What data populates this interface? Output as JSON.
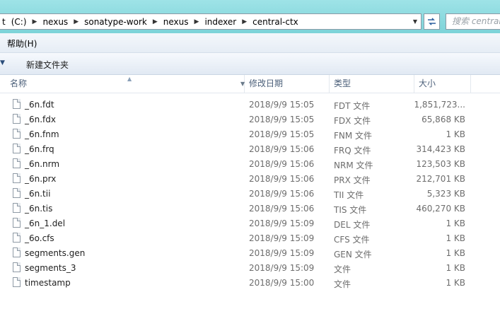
{
  "address": {
    "crumbs": [
      "(C:)",
      "nexus",
      "sonatype-work",
      "nexus",
      "indexer",
      "central-ctx"
    ],
    "prefix_fragment": "t",
    "search_placeholder": "搜索 central-ctx"
  },
  "menu": {
    "help": "帮助(H)"
  },
  "toolbar": {
    "new_folder": "新建文件夹"
  },
  "columns": {
    "name": "名称",
    "date": "修改日期",
    "type": "类型",
    "size": "大小"
  },
  "files": [
    {
      "name": "_6n.fdt",
      "date": "2018/9/9 15:05",
      "type": "FDT 文件",
      "size": "1,851,723..."
    },
    {
      "name": "_6n.fdx",
      "date": "2018/9/9 15:05",
      "type": "FDX 文件",
      "size": "65,868 KB"
    },
    {
      "name": "_6n.fnm",
      "date": "2018/9/9 15:05",
      "type": "FNM 文件",
      "size": "1 KB"
    },
    {
      "name": "_6n.frq",
      "date": "2018/9/9 15:06",
      "type": "FRQ 文件",
      "size": "314,423 KB"
    },
    {
      "name": "_6n.nrm",
      "date": "2018/9/9 15:06",
      "type": "NRM 文件",
      "size": "123,503 KB"
    },
    {
      "name": "_6n.prx",
      "date": "2018/9/9 15:06",
      "type": "PRX 文件",
      "size": "212,701 KB"
    },
    {
      "name": "_6n.tii",
      "date": "2018/9/9 15:06",
      "type": "TII 文件",
      "size": "5,323 KB"
    },
    {
      "name": "_6n.tis",
      "date": "2018/9/9 15:06",
      "type": "TIS 文件",
      "size": "460,270 KB"
    },
    {
      "name": "_6n_1.del",
      "date": "2018/9/9 15:09",
      "type": "DEL 文件",
      "size": "1 KB"
    },
    {
      "name": "_6o.cfs",
      "date": "2018/9/9 15:09",
      "type": "CFS 文件",
      "size": "1 KB"
    },
    {
      "name": "segments.gen",
      "date": "2018/9/9 15:09",
      "type": "GEN 文件",
      "size": "1 KB"
    },
    {
      "name": "segments_3",
      "date": "2018/9/9 15:09",
      "type": "文件",
      "size": "1 KB"
    },
    {
      "name": "timestamp",
      "date": "2018/9/9 15:00",
      "type": "文件",
      "size": "1 KB"
    }
  ]
}
